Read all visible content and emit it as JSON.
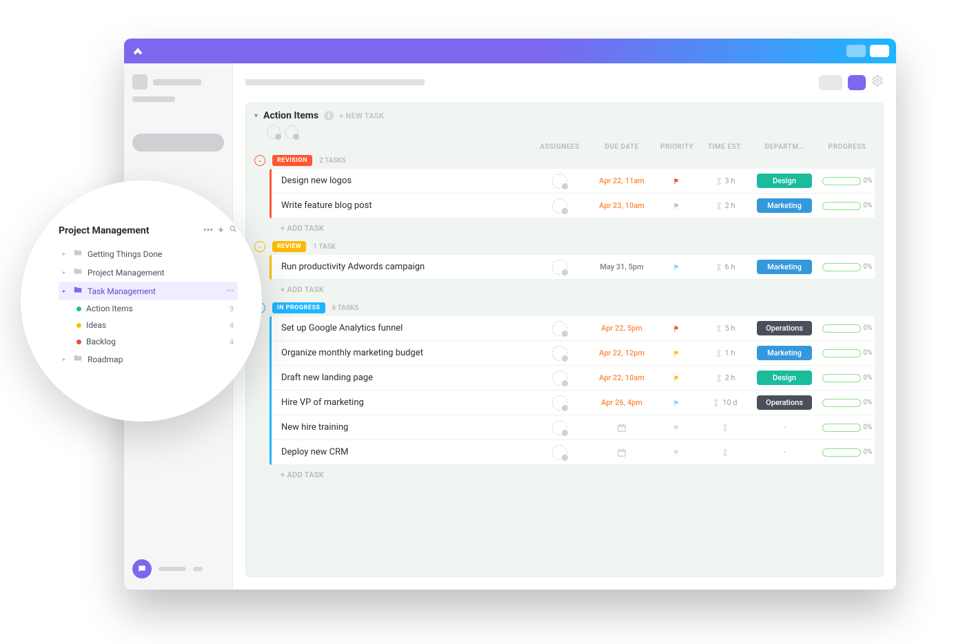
{
  "bubble": {
    "title": "Project Management",
    "more_icon": "•••",
    "items": [
      {
        "type": "folder",
        "label": "Getting Things Done"
      },
      {
        "type": "folder",
        "label": "Project Management"
      },
      {
        "type": "folder",
        "label": "Task Management",
        "selected": true,
        "more": "•••"
      },
      {
        "type": "list",
        "label": "Action Items",
        "dot": "green",
        "count": "9"
      },
      {
        "type": "list",
        "label": "Ideas",
        "dot": "yellow",
        "count": "4"
      },
      {
        "type": "list",
        "label": "Backlog",
        "dot": "red",
        "count": "4"
      },
      {
        "type": "folder",
        "label": "Roadmap"
      }
    ]
  },
  "list": {
    "title": "Action Items",
    "new_task": "+ NEW TASK",
    "add_task": "+ ADD TASK",
    "columns": {
      "assignees": "ASSIGNEES",
      "due": "DUE DATE",
      "priority": "PRIORITY",
      "time": "TIME EST.",
      "dept": "DEPARTM…",
      "progress": "PROGRESS"
    },
    "groups": [
      {
        "status": "REVISION",
        "cls": "revision",
        "count": "2 TASKS",
        "tasks": [
          {
            "name": "Design new logos",
            "due": "Apr 22, 11am",
            "due_cls": "orange",
            "flag": "#e74c3c",
            "time": "3 h",
            "dept": "Design",
            "dept_cls": "design",
            "progress": "0%"
          },
          {
            "name": "Write feature blog post",
            "due": "Apr 23, 10am",
            "due_cls": "orange",
            "flag": "#b9bcba",
            "time": "2 h",
            "dept": "Marketing",
            "dept_cls": "marketing",
            "progress": "0%"
          }
        ]
      },
      {
        "status": "REVIEW",
        "cls": "review",
        "count": "1 TASK",
        "tasks": [
          {
            "name": "Run productivity Adwords campaign",
            "due": "May 31, 5pm",
            "due_cls": "grey",
            "flag": "#7fd3ff",
            "time": "6 h",
            "dept": "Marketing",
            "dept_cls": "marketing",
            "progress": "0%"
          }
        ]
      },
      {
        "status": "IN PROGRESS",
        "cls": "progress",
        "count": "6 TASKS",
        "tasks": [
          {
            "name": "Set up Google Analytics funnel",
            "due": "Apr 22, 5pm",
            "due_cls": "orange",
            "flag": "#e74c3c",
            "time": "5 h",
            "dept": "Operations",
            "dept_cls": "operations",
            "progress": "0%"
          },
          {
            "name": "Organize monthly marketing budget",
            "due": "Apr 22, 12pm",
            "due_cls": "orange",
            "flag": "#fbbc05",
            "time": "1 h",
            "dept": "Marketing",
            "dept_cls": "marketing",
            "progress": "0%"
          },
          {
            "name": "Draft new landing page",
            "due": "Apr 22, 10am",
            "due_cls": "orange",
            "flag": "#fbbc05",
            "time": "2 h",
            "dept": "Design",
            "dept_cls": "design",
            "progress": "0%"
          },
          {
            "name": "Hire VP of marketing",
            "due": "Apr 26, 4pm",
            "due_cls": "orange",
            "flag": "#7fd3ff",
            "time": "10 d",
            "dept": "Operations",
            "dept_cls": "operations",
            "progress": "0%"
          },
          {
            "name": "New hire training",
            "due": "",
            "due_cls": "",
            "flag": "#d7dad8",
            "time": "",
            "dept": "-",
            "dept_cls": "",
            "progress": "0%"
          },
          {
            "name": "Deploy new CRM",
            "due": "",
            "due_cls": "",
            "flag": "#d7dad8",
            "time": "",
            "dept": "-",
            "dept_cls": "",
            "progress": "0%"
          }
        ]
      }
    ]
  }
}
